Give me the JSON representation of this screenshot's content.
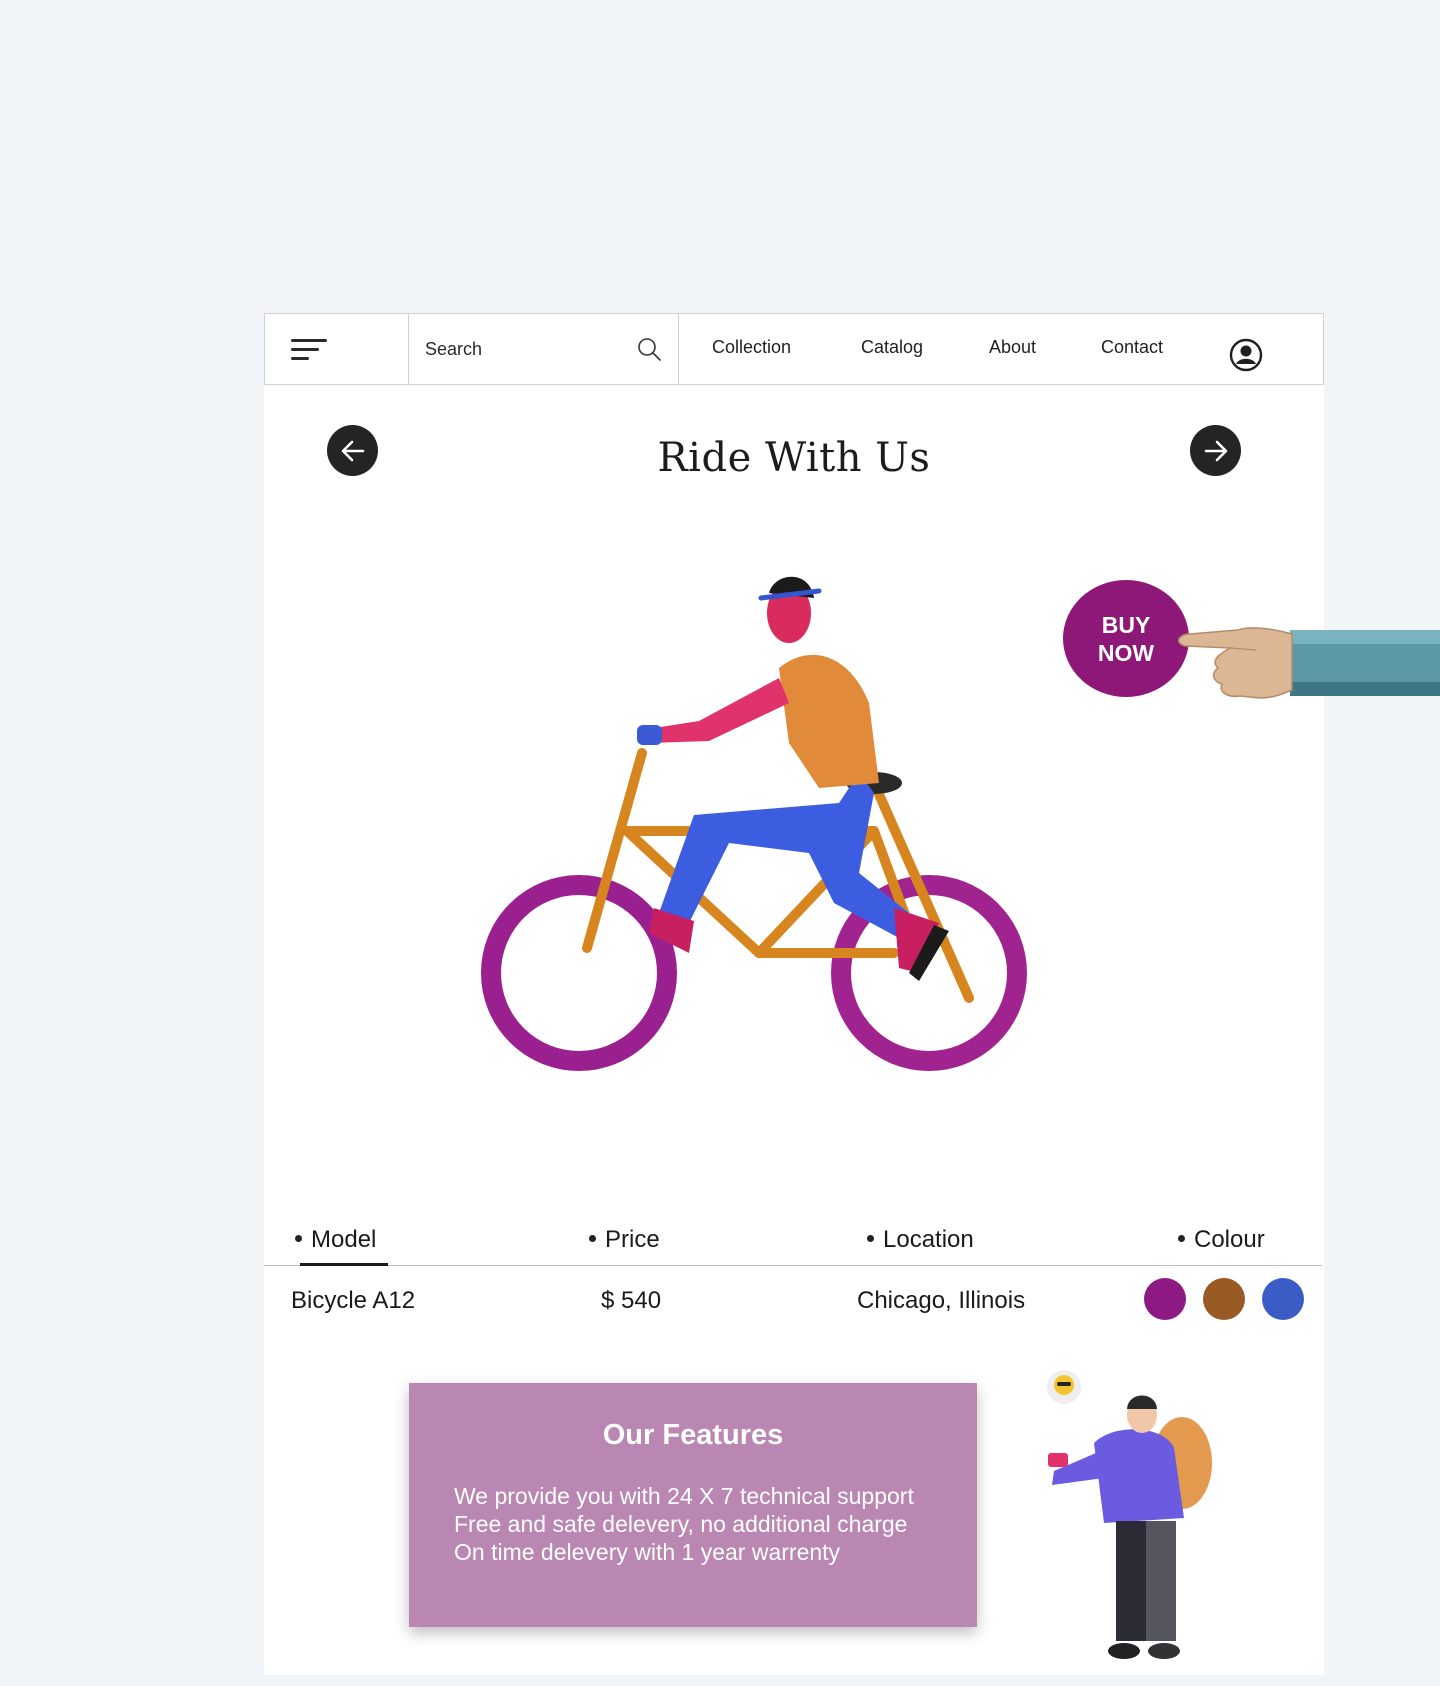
{
  "nav": {
    "search_placeholder": "Search",
    "links": [
      "Collection",
      "Catalog",
      "About",
      "Contact"
    ]
  },
  "hero": {
    "title": "Ride With Us",
    "buy_now_line1": "BUY",
    "buy_now_line2": "NOW"
  },
  "specs": {
    "headers": [
      "Model",
      "Price",
      "Location",
      "Colour"
    ],
    "values": [
      "Bicycle A12",
      "$ 540",
      "Chicago, Illinois"
    ],
    "colours": [
      "#8c1a82",
      "#9a5a24",
      "#3b5cc4"
    ]
  },
  "features": {
    "title": "Our Features",
    "lines": [
      "We provide you with 24 X 7 technical support",
      "Free and safe delevery, no additional charge",
      "On time delevery with 1 year warrenty"
    ]
  },
  "colors": {
    "brand": "#8e1877",
    "features_bg": "#b987b2",
    "page_bg": "#f2f5f8"
  }
}
